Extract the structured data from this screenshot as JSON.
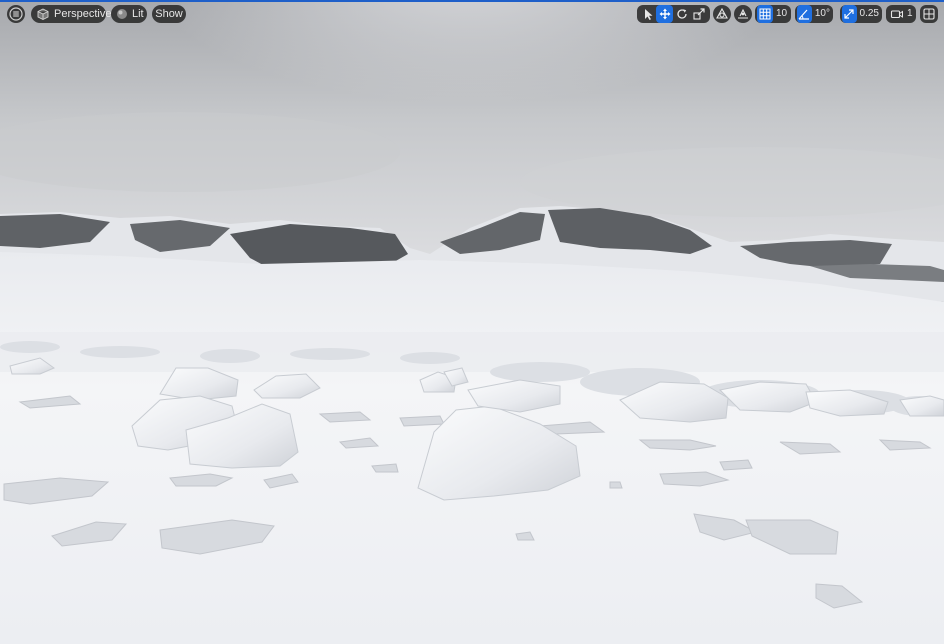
{
  "toolbar": {
    "menu_icon": "hamburger-menu-icon",
    "view_mode": {
      "icon": "perspective-cube-icon",
      "label": "Perspective"
    },
    "lighting": {
      "icon": "lit-sphere-icon",
      "label": "Lit"
    },
    "show_label": "Show",
    "transform_tools": [
      {
        "icon": "select-cursor-icon",
        "active": false
      },
      {
        "icon": "translate-move-icon",
        "active": true
      },
      {
        "icon": "rotate-icon",
        "active": false
      },
      {
        "icon": "scale-icon",
        "active": false
      }
    ],
    "coordinate_space_icon": "world-space-icon",
    "surface_snap_icon": "surface-snap-icon",
    "grid_snap": {
      "icon": "grid-snap-icon",
      "value": "10",
      "active": true
    },
    "rotation_snap": {
      "icon": "angle-snap-icon",
      "value": "10°",
      "active": true
    },
    "scale_snap": {
      "icon": "scale-snap-icon",
      "value": "0.25",
      "active": true
    },
    "camera_speed": {
      "icon": "camera-speed-icon",
      "value": "1"
    },
    "layout_icon": "viewport-layout-icon"
  },
  "colors": {
    "accent": "#1f6fe0",
    "toolbar_bg": "#262626",
    "sky_top": "#a9abae",
    "sky_bottom": "#d9dadd",
    "snow": "#eef0f3",
    "rock": "#5b5e62"
  }
}
